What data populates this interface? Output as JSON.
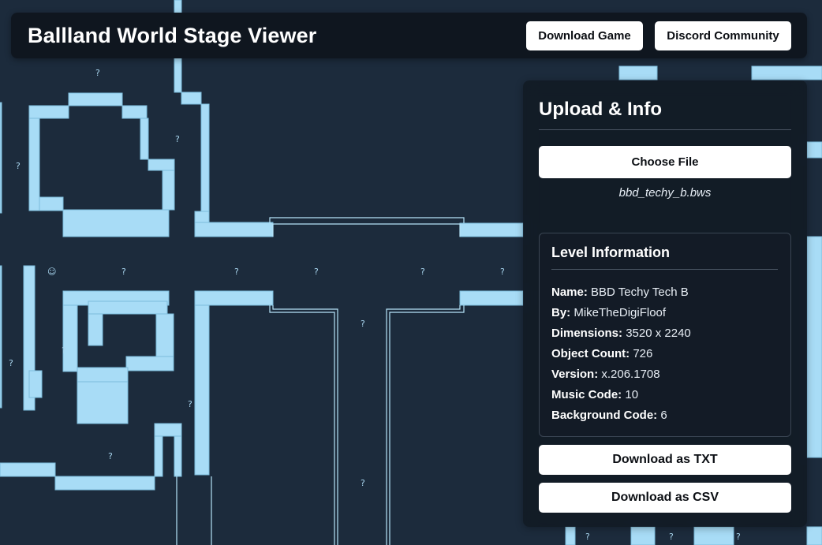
{
  "header": {
    "title": "Ballland World Stage Viewer",
    "download_game_label": "Download Game",
    "discord_label": "Discord Community"
  },
  "panel": {
    "title": "Upload & Info",
    "choose_file_label": "Choose File",
    "file_name": "bbd_techy_b.bws",
    "level_info": {
      "title": "Level Information",
      "fields": [
        {
          "label": "Name:",
          "value": "BBD Techy Tech B"
        },
        {
          "label": "By:",
          "value": "MikeTheDigiFloof"
        },
        {
          "label": "Dimensions:",
          "value": "3520 x 2240"
        },
        {
          "label": "Object Count:",
          "value": "726"
        },
        {
          "label": "Version:",
          "value": "x.206.1708"
        },
        {
          "label": "Music Code:",
          "value": "10"
        },
        {
          "label": "Background Code:",
          "value": "6"
        }
      ]
    },
    "download_txt_label": "Download as TXT",
    "download_csv_label": "Download as CSV"
  },
  "stage": {
    "unknown_marker": "?",
    "smiley_marker": "☺"
  },
  "colors": {
    "background": "#1c2b3c",
    "tile": "#a8dcf6",
    "panel": "#0f161f",
    "button": "#ffffff"
  }
}
